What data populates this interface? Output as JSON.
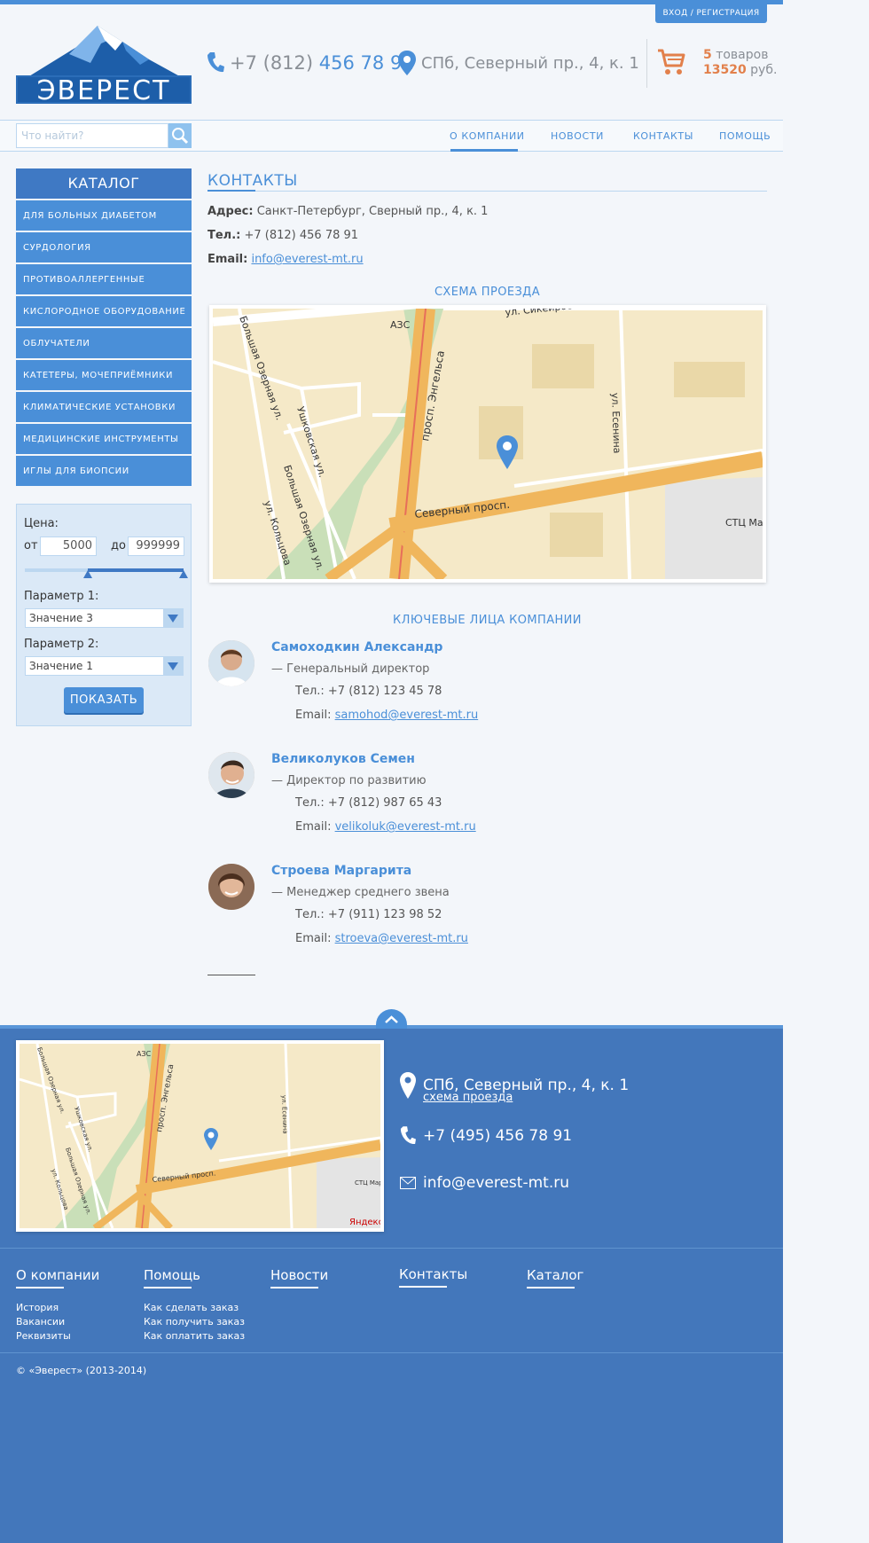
{
  "header": {
    "login": "ВХОД / РЕГИСТРАЦИЯ",
    "logo_text": "ЭВЕРЕСТ",
    "phone_prefix": "+7 (812)",
    "phone_main": "456 78 91",
    "address": "СПб, Северный пр., 4, к. 1",
    "cart_count": "5",
    "cart_count_label": "товаров",
    "cart_sum": "13520",
    "cart_currency": "руб."
  },
  "search": {
    "placeholder": "Что найти?"
  },
  "nav": {
    "items": [
      "О КОМПАНИИ",
      "НОВОСТИ",
      "КОНТАКТЫ",
      "ПОМОЩЬ"
    ]
  },
  "catalog": {
    "title": "КАТАЛОГ",
    "items": [
      "ДЛЯ БОЛЬНЫХ ДИАБЕТОМ",
      "СУРДОЛОГИЯ",
      "ПРОТИВОАЛЛЕРГЕННЫЕ",
      "КИСЛОРОДНОЕ ОБОРУДОВАНИЕ",
      "ОБЛУЧАТЕЛИ",
      "КАТЕТЕРЫ, МОЧЕПРИЁМНИКИ",
      "КЛИМАТИЧЕСКИЕ УСТАНОВКИ",
      "МЕДИЦИНСКИЕ ИНСТРУМЕНТЫ",
      "ИГЛЫ ДЛЯ БИОПСИИ"
    ]
  },
  "filter": {
    "price_label": "Цена:",
    "from_label": "от",
    "from_value": "5000",
    "to_label": "до",
    "to_value": "999999",
    "param1_label": "Параметр 1:",
    "param1_value": "Значение 3",
    "param2_label": "Параметр 2:",
    "param2_value": "Значение 1",
    "submit": "ПОКАЗАТЬ"
  },
  "content": {
    "title": "КОНТАКТЫ",
    "address_label": "Адрес:",
    "address_value": "Санкт-Петербург, Сверный пр., 4, к. 1",
    "tel_label": "Тел.:",
    "tel_value": "+7 (812) 456 78 91",
    "email_label": "Email:",
    "email_value": "info@everest-mt.ru",
    "map_title": "СХЕМА ПРОЕЗДА",
    "people_title": "КЛЮЧЕВЫЕ ЛИЦА КОМПАНИИ",
    "people": [
      {
        "name": "Самоходкин Александр",
        "role": "— Генеральный директор",
        "tel": "Тел.: +7 (812) 123 45 78",
        "email_label": "Email:",
        "email": "samohod@everest-mt.ru"
      },
      {
        "name": "Великолуков Семен",
        "role": "— Директор по развитию",
        "tel": "Тел.: +7 (812) 987 65 43",
        "email_label": "Email:",
        "email": "velikoluk@everest-mt.ru"
      },
      {
        "name": "Строева Маргарита",
        "role": "— Менеджер среднего звена",
        "tel": "Тел.: +7 (911) 123 98 52",
        "email_label": "Email:",
        "email": "stroeva@everest-mt.ru"
      }
    ]
  },
  "map_labels": {
    "azs": "АЗС",
    "sikeyros": "ул. Сикейроса",
    "engels": "просп. Энгельса",
    "esenina": "ул. Есенина",
    "bolshaya_ozernaya": "Большая Озерная ул.",
    "ushkovskaya": "Ушковская ул.",
    "koltsova": "ул. Кольцова",
    "severny": "Северный просп.",
    "stc": "СТЦ Мар",
    "yandex": "Яндекс"
  },
  "footer": {
    "address": "СПб, Северный пр., 4, к. 1",
    "map_link": "схема проезда",
    "phone": "+7 (495) 456 78 91",
    "email": "info@everest-mt.ru",
    "columns": [
      {
        "title": "О компании",
        "links": [
          "История",
          "Вакансии",
          "Реквизиты"
        ]
      },
      {
        "title": "Помощь",
        "links": [
          "Как сделать заказ",
          "Как получить заказ",
          "Как оплатить заказ"
        ]
      },
      {
        "title": "Новости",
        "links": []
      },
      {
        "title": "Контакты",
        "links": []
      },
      {
        "title": "Каталог",
        "links": []
      }
    ],
    "copyright": "© «Эверест» (2013-2014)"
  },
  "colors": {
    "accent": "#4a8fd8",
    "accent_dark": "#3f79c4",
    "cart_highlight": "#e2804b",
    "footer_bg": "#4377bb"
  }
}
